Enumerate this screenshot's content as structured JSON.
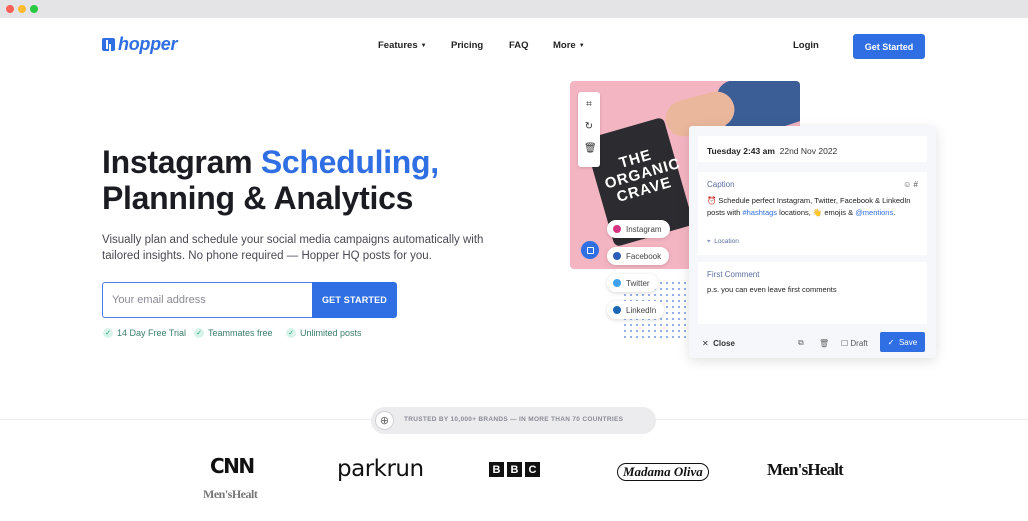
{
  "nav": {
    "logo": "hopper",
    "features": "Features",
    "pricing": "Pricing",
    "faq": "FAQ",
    "more": "More",
    "login": "Login",
    "get_started": "Get Started"
  },
  "hero": {
    "headline_1": "Instagram",
    "headline_accent": "Scheduling,",
    "headline_2": "Planning & Analytics",
    "subheading": "Visually plan and schedule your social media campaigns automatically with tailored insights. No phone required — Hopper HQ posts for you.",
    "email_placeholder": "Your email address",
    "cta": "GET STARTED",
    "perks": [
      "14 Day Free Trial",
      "Teammates free",
      "Unlimited posts"
    ]
  },
  "mockup": {
    "bag_label": "THE ORGANIC CRAVE",
    "networks": [
      "Instagram",
      "Facebook",
      "Twitter",
      "LinkedIn"
    ],
    "date_bold": "Tuesday 2:43 am",
    "date_rest": "22nd Nov 2022",
    "caption_label": "Caption",
    "caption_line_1": "⏰ Schedule perfect Instagram, Twitter, Facebook & LinkedIn",
    "caption_pre": "posts with ",
    "caption_hashtags": "#hashtags",
    "caption_mid": " locations, 👋 emojis & ",
    "caption_mentions": "@mentions",
    "caption_end": ".",
    "location": "Location",
    "first_comment_label": "First Comment",
    "first_comment_text": "p.s. you can even leave first comments",
    "close": "Close",
    "draft": "Draft",
    "save": "Save"
  },
  "trust": {
    "text": "TRUSTED BY 10,000+ BRANDS — IN MORE THAN 70 COUNTRIES",
    "brands": [
      "CNN",
      "Men'sHealt",
      "parkrun",
      "B",
      "B",
      "C",
      "Madama Oliva",
      "Men'sHealt"
    ]
  },
  "colors": {
    "brand_blue": "#2f6fe3",
    "perk_green": "#22a37a",
    "photo_pink": "#f4b5c2"
  },
  "icons": [
    "crop-icon",
    "rotate-icon",
    "trash-icon",
    "copy-icon",
    "emoji-icon",
    "hash-icon",
    "location-pin-icon",
    "close-icon",
    "duplicate-icon",
    "delete-icon",
    "checkbox-icon",
    "check-icon",
    "globe-icon"
  ]
}
